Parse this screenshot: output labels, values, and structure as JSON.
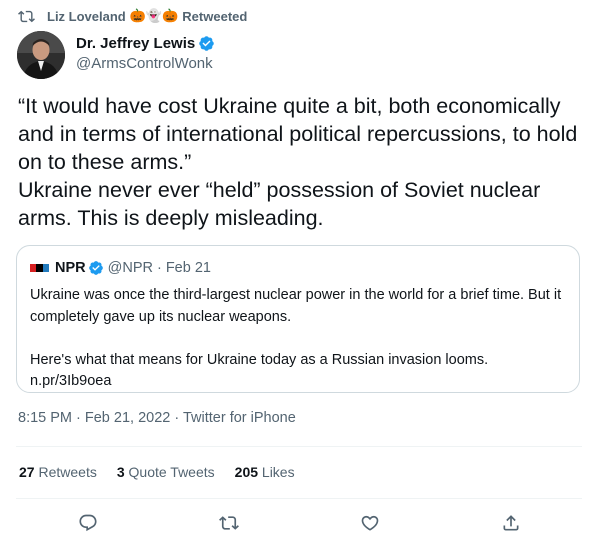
{
  "retweet": {
    "icon": "retweet-icon",
    "name": "Liz Loveland",
    "emoji": "🎃👻🎃",
    "label": "Retweeted"
  },
  "author": {
    "display_name": "Dr. Jeffrey Lewis",
    "handle": "@ArmsControlWonk",
    "verified": true
  },
  "tweet": {
    "text": "“It would have cost Ukraine quite a bit, both economically and in terms of international political repercussions, to hold on to these arms.”\nUkraine never ever “held” possession of Soviet nuclear arms. This is deeply misleading."
  },
  "quote": {
    "name": "NPR",
    "handle": "@NPR",
    "separator": "·",
    "date": "Feb 21",
    "text": "Ukraine was once the third-largest nuclear power in the world for a brief time. But it completely gave up its nuclear weapons.\n\nHere's what that means for Ukraine today as a Russian invasion looms.\nn.pr/3Ib9oea",
    "logo_colors": [
      "#d62021",
      "#000000",
      "#237bbd"
    ]
  },
  "meta": {
    "timestamp": "8:15 PM · Feb 21, 2022 · Twitter for iPhone"
  },
  "stats": {
    "retweets_count": "27",
    "retweets_label": "Retweets",
    "quotes_count": "3",
    "quotes_label": "Quote Tweets",
    "likes_count": "205",
    "likes_label": "Likes"
  },
  "colors": {
    "verified": "#1d9bf0",
    "secondary_text": "#536471",
    "primary_text": "#0f1419",
    "border": "#cfd9de"
  },
  "actions": [
    "reply-icon",
    "retweet-icon",
    "like-icon",
    "share-icon"
  ]
}
